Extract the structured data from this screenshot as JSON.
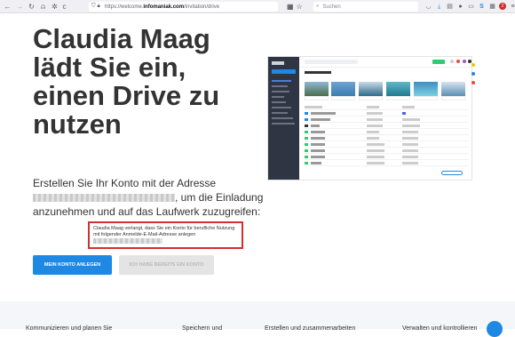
{
  "browser": {
    "url_prefix": "https://welcome.",
    "url_domain": "infomaniak.com",
    "url_path": "/invitation/drive",
    "search_placeholder": "Suchen",
    "notification_count": "2"
  },
  "hero": {
    "headline": "Claudia Maag lädt Sie ein, einen Drive zu nutzen",
    "text_before": "Erstellen Sie Ihr Konto mit der Adresse ",
    "text_after": ", um die Einladung anzunehmen und auf das Laufwerk zuzugreifen:"
  },
  "tooltip": {
    "text": "Claudia Maag verlangt, dass Sie ein Konto für berufliche Nutzung mit folgender Anmelde-E-Mail-Adresse anlegen"
  },
  "buttons": {
    "create_account": "MEIN KONTO ANLEGEN",
    "have_account": "ICH HABE BEREITS EIN KONTO"
  },
  "footer": {
    "items": [
      "Kommunizieren und planen Sie",
      "Speichern und",
      "Erstellen und zusammenarbeiten",
      "Verwalten und kontrollieren"
    ]
  }
}
